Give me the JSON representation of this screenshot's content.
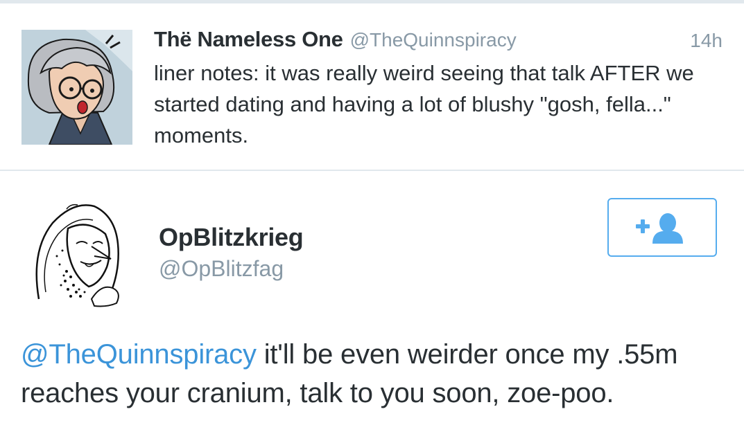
{
  "colors": {
    "text": "#292f33",
    "muted": "#8899a6",
    "link": "#3b94d9",
    "accent": "#55acee",
    "divider": "#e1e8ed"
  },
  "tweet1": {
    "avatar_icon": "comic-avatar-gray-haired-woman-with-glasses",
    "author_name": "Thë Nameless One",
    "author_handle": "@TheQuinnspiracy",
    "time": "14h",
    "text": "liner notes: it was really weird seeing that talk AFTER we started dating and having a lot of blushy \"gosh, fella...\" moments."
  },
  "tweet2": {
    "avatar_icon": "sketch-avatar-masked-figure",
    "author_name": "OpBlitzkrieg",
    "author_handle": "@OpBlitzfag",
    "follow_button_icon": "follow-user-plus-icon",
    "mention": "@TheQuinnspiracy",
    "text": " it'll be even weirder once my .55m reaches your cranium, talk to you soon, zoe-poo."
  }
}
